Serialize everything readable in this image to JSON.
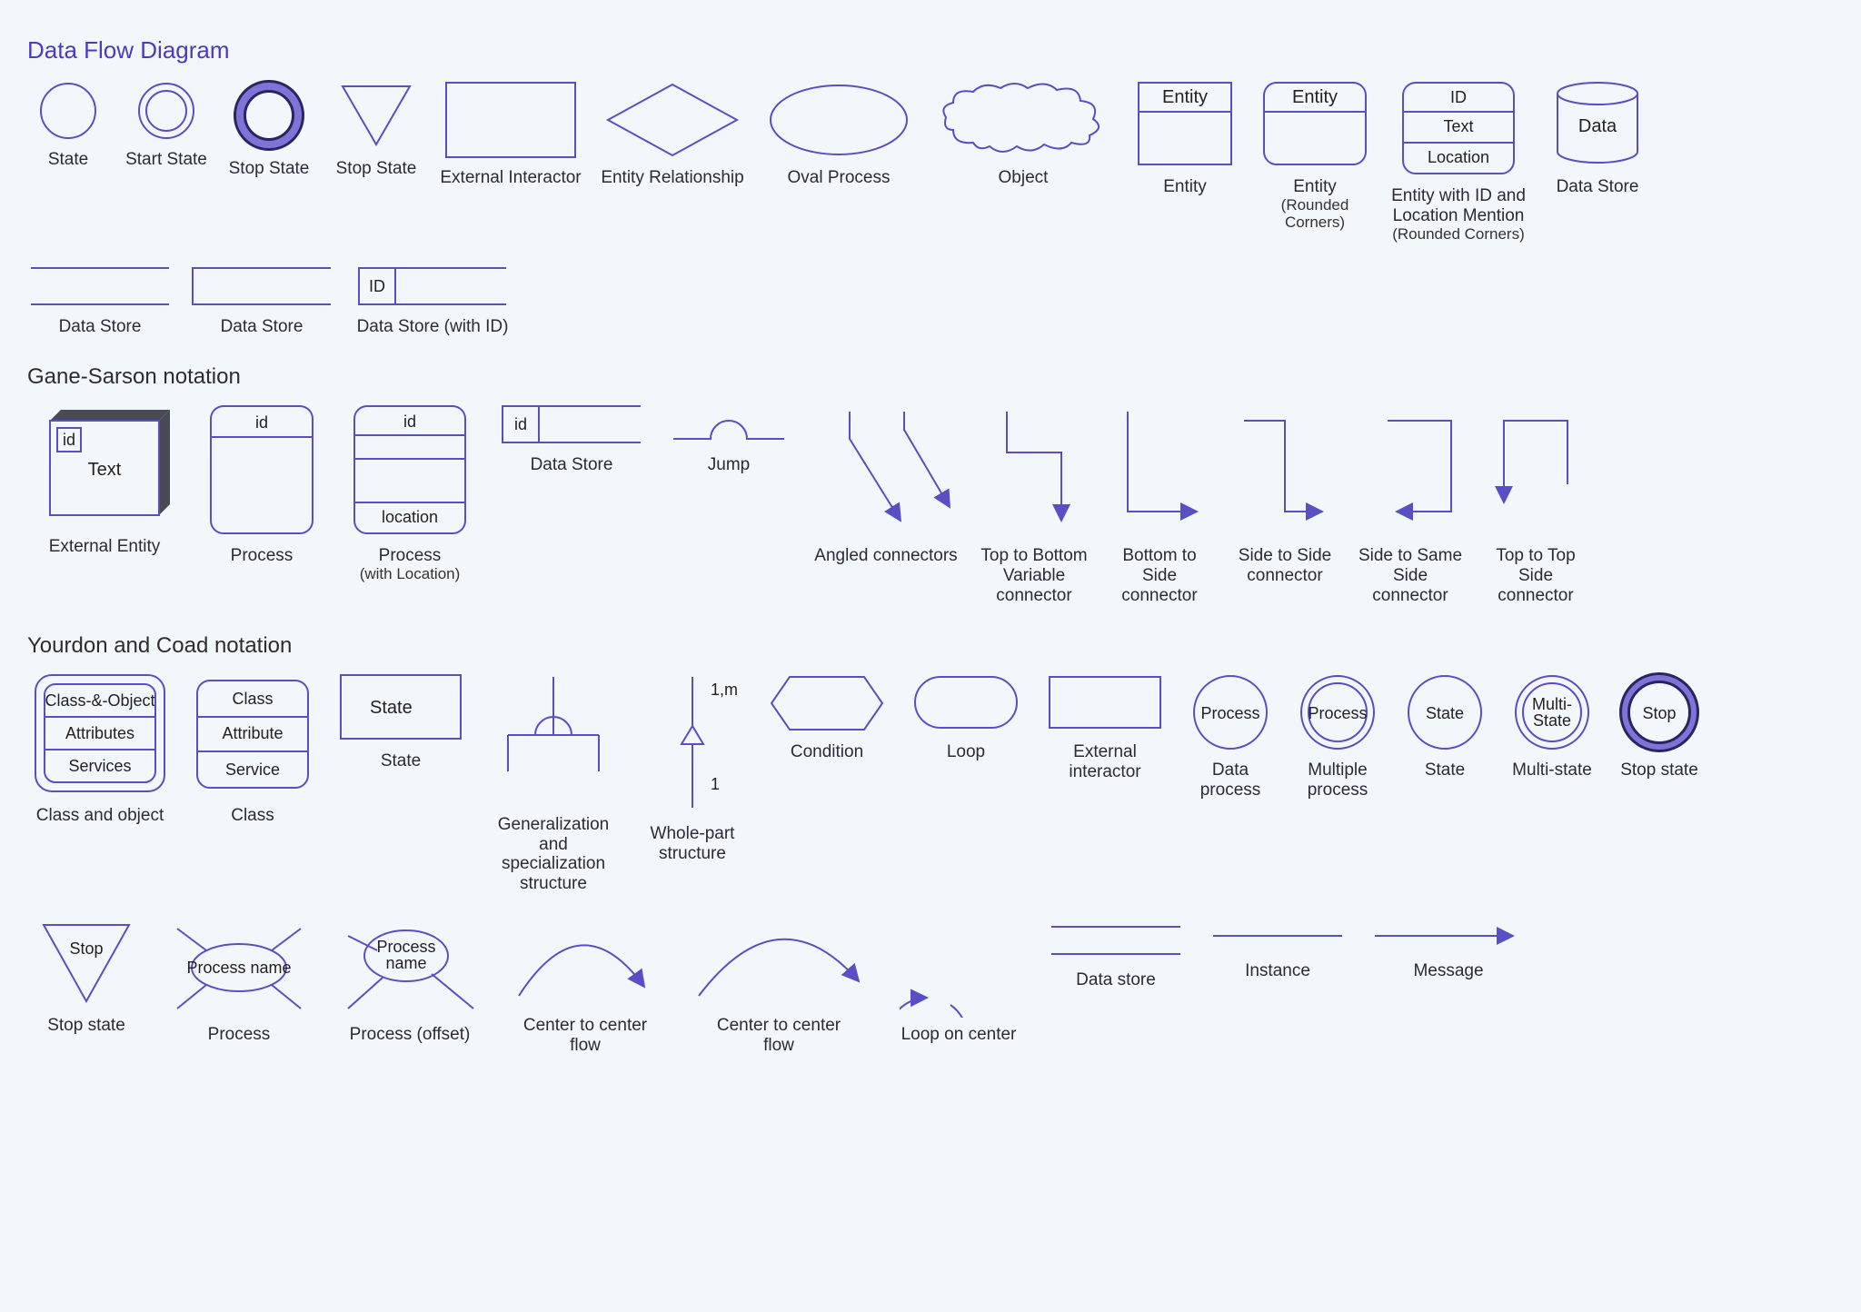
{
  "section1": {
    "title": "Data Flow Diagram",
    "items": [
      {
        "label": "State"
      },
      {
        "label": "Start State"
      },
      {
        "label": "Stop State"
      },
      {
        "label": "Stop State"
      },
      {
        "label": "External Interactor"
      },
      {
        "label": "Entity Relationship"
      },
      {
        "label": "Oval Process"
      },
      {
        "label": "Object"
      },
      {
        "label": "Entity",
        "text": "Entity"
      },
      {
        "label": "Entity",
        "sub": "(Rounded Corners)",
        "text": "Entity"
      },
      {
        "label": "Entity with ID and Location Mention",
        "sub": "(Rounded Corners)",
        "id": "ID",
        "text": "Text",
        "location": "Location"
      },
      {
        "label": "Data Store",
        "text": "Data"
      }
    ],
    "row2": [
      {
        "label": "Data Store"
      },
      {
        "label": "Data Store"
      },
      {
        "label": "Data Store (with ID)",
        "id": "ID"
      }
    ]
  },
  "section2": {
    "title": "Gane-Sarson notation",
    "items": [
      {
        "label": "External Entity",
        "id": "id",
        "text": "Text"
      },
      {
        "label": "Process",
        "id": "id"
      },
      {
        "label": "Process",
        "sub": "(with Location)",
        "id": "id",
        "location": "location"
      },
      {
        "label": "Data Store",
        "id": "id"
      },
      {
        "label": "Jump"
      },
      {
        "label": "Angled connectors"
      },
      {
        "label": "Top to Bottom Variable connector"
      },
      {
        "label": "Bottom to Side connector"
      },
      {
        "label": "Side to Side connector"
      },
      {
        "label": "Side to Same Side connector"
      },
      {
        "label": "Top to Top Side connector"
      }
    ]
  },
  "section3": {
    "title": "Yourdon and Coad notation",
    "row1": [
      {
        "label": "Class and object",
        "t1": "Class-&-Object",
        "t2": "Attributes",
        "t3": "Services"
      },
      {
        "label": "Class",
        "t1": "Class",
        "t2": "Attribute",
        "t3": "Service"
      },
      {
        "label": "State",
        "text": "State"
      },
      {
        "label": "Generalization and specialization structure"
      },
      {
        "label": "Whole-part structure",
        "top": "1,m",
        "bottom": "1"
      },
      {
        "label": "Condition"
      },
      {
        "label": "Loop"
      },
      {
        "label": "External interactor"
      },
      {
        "label": "Data process",
        "text": "Process"
      },
      {
        "label": "Multiple process",
        "text": "Process"
      },
      {
        "label": "State",
        "text": "State"
      },
      {
        "label": "Multi-state",
        "text": "Multi-State"
      },
      {
        "label": "Stop state",
        "text": "Stop"
      }
    ],
    "row2": [
      {
        "label": "Stop state",
        "text": "Stop"
      },
      {
        "label": "Process",
        "text": "Process name"
      },
      {
        "label": "Process (offset)",
        "text": "Process name"
      },
      {
        "label": "Center to center flow"
      },
      {
        "label": "Center to center flow"
      },
      {
        "label": "Loop on center"
      },
      {
        "label": "Data store"
      },
      {
        "label": "Instance"
      },
      {
        "label": "Message"
      }
    ]
  }
}
